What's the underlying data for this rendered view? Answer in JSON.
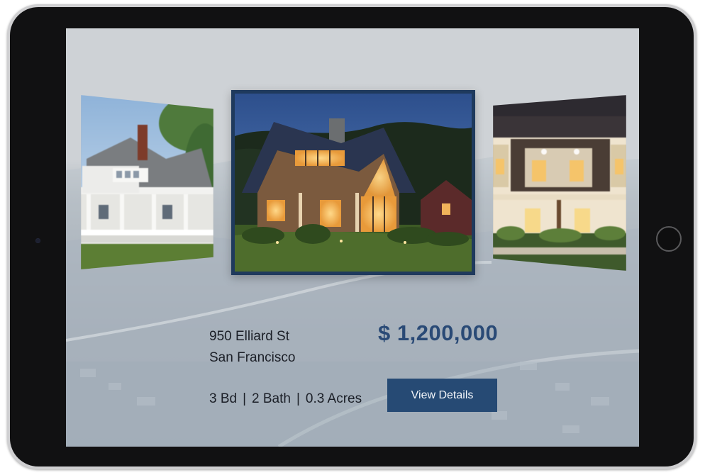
{
  "listing": {
    "street": "950 Elliard St",
    "city": "San Francisco",
    "price": "$ 1,200,000",
    "beds": "3 Bd",
    "baths": "2 Bath",
    "lot": "0.3 Acres",
    "separator": "|"
  },
  "actions": {
    "view_details_label": "View Details"
  },
  "colors": {
    "accent": "#264a74",
    "price": "#2a4a76",
    "frame": "#1f3a5d"
  },
  "carousel": {
    "left_photo_icon": "house-photo-icon",
    "center_photo_icon": "house-photo-icon",
    "right_photo_icon": "house-photo-icon"
  }
}
